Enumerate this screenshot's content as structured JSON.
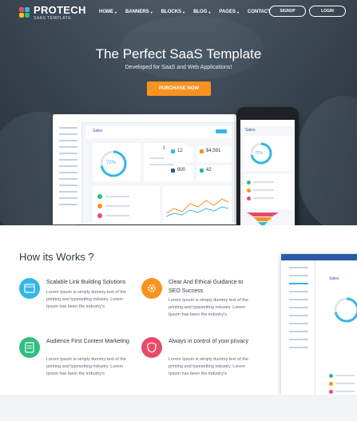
{
  "brand": {
    "name": "PROTECH",
    "tagline": "SAAS TEMPLATE"
  },
  "nav": {
    "items": [
      {
        "label": "HOME",
        "caret": "▾"
      },
      {
        "label": "BANNERS",
        "caret": "▾"
      },
      {
        "label": "BLOCKS",
        "caret": "▾"
      },
      {
        "label": "BLOG",
        "caret": "▾"
      },
      {
        "label": "PAGES",
        "caret": "▾"
      },
      {
        "label": "CONTACT",
        "caret": ""
      }
    ],
    "signup_label": "SIGNUP",
    "login_label": "LOGIN"
  },
  "hero": {
    "title": "The Perfect SaaS Template",
    "subtitle": "Developed for SaaS and Web Applications!",
    "cta_label": "PURCHASE NOW"
  },
  "dashboard": {
    "header": "Sales",
    "stat_percent": "72%",
    "stats": [
      "1",
      "12",
      "$4,591",
      "900",
      "42"
    ]
  },
  "phone": {
    "header": "Sales",
    "stat_percent": "72%"
  },
  "how": {
    "title": "How its Works ?",
    "features": [
      {
        "title": "Scalable Link Building Solutions",
        "text": "Lorem Ipsum is simply dummy text of the printing and typesetting industry. Lorem Ipsum has been the industry's",
        "icon": "browser-icon",
        "color": "#35b6e8"
      },
      {
        "title": "Clear And Ethical Guidance to SEO Success",
        "text": "Lorem Ipsum is simply dummy text of the printing and typesetting industry. Lorem Ipsum has been the industry's",
        "icon": "gear-icon",
        "color": "#f7931e"
      },
      {
        "title": "Audience First Content Marketing",
        "text": "Lorem Ipsum is simply dummy text of the printing and typesetting industry. Lorem Ipsum has been the industry's",
        "icon": "document-icon",
        "color": "#2ebf7e"
      },
      {
        "title": "Always in control of your privacy",
        "text": "Lorem Ipsum is simply dummy text of the printing and typesetting industry. Lorem Ipsum has been the industry's",
        "icon": "shield-icon",
        "color": "#e84b6a"
      }
    ]
  },
  "right_mock": {
    "header": "Sales"
  },
  "colors": {
    "accent": "#f7931e",
    "primary": "#2a5aa8"
  }
}
